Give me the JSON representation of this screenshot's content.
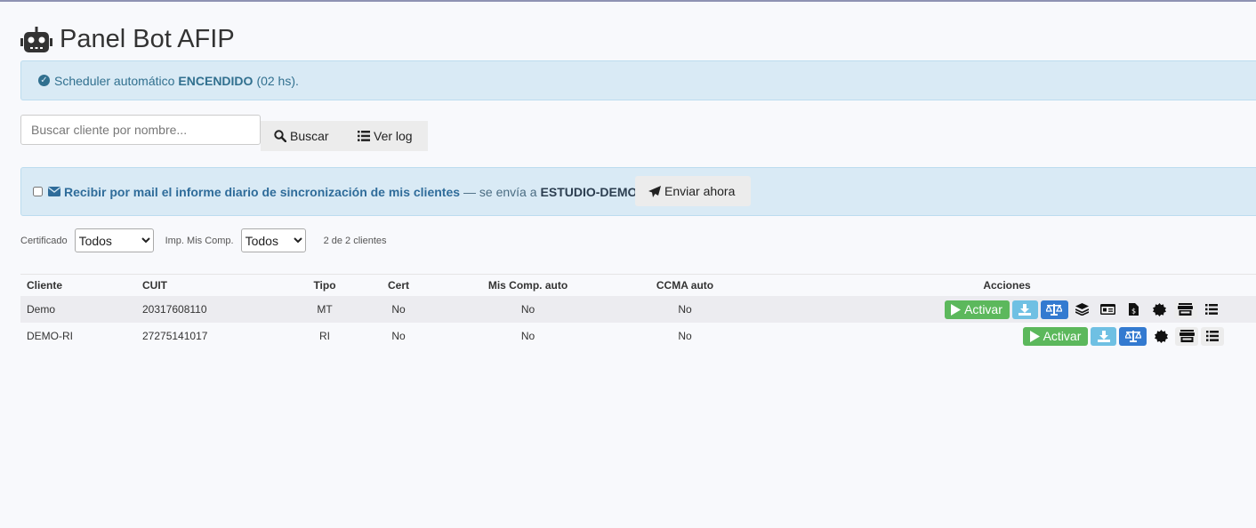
{
  "header": {
    "title": "Panel Bot AFIP",
    "icon": "robot-icon"
  },
  "scheduler": {
    "prefix": "Scheduler automático",
    "status": "ENCENDIDO",
    "suffix": "(02 hs)."
  },
  "search": {
    "placeholder": "Buscar cliente por nombre...",
    "value": "",
    "button_label": "Buscar",
    "log_label": "Ver log"
  },
  "mail": {
    "label": "Recibir por mail el informe diario de sincronización de mis clientes",
    "sent_to_text": "— se envía a",
    "recipient": "ESTUDIO-DEMO",
    "send_label": "Enviar ahora",
    "checked": false
  },
  "filters": {
    "cert_label": "Certificado",
    "cert_value": "Todos",
    "imp_label": "Imp. Mis Comp.",
    "imp_value": "Todos",
    "count": "2 de 2 clientes"
  },
  "table": {
    "headers": [
      "Cliente",
      "CUIT",
      "Tipo",
      "Cert",
      "Mis Comp. auto",
      "CCMA auto",
      "Acciones"
    ],
    "rows": [
      {
        "cliente": "Demo",
        "cuit": "20317608110",
        "tipo": "MT",
        "cert": "No",
        "mis_comp": "No",
        "ccma": "No",
        "activar": "Activar"
      },
      {
        "cliente": "DEMO-RI",
        "cuit": "27275141017",
        "tipo": "RI",
        "cert": "No",
        "mis_comp": "No",
        "ccma": "No",
        "activar": "Activar"
      }
    ]
  },
  "colors": {
    "accent_info": "#31708f",
    "success": "#5cb85c",
    "primary": "#337ad0",
    "info": "#6fc0e3"
  }
}
